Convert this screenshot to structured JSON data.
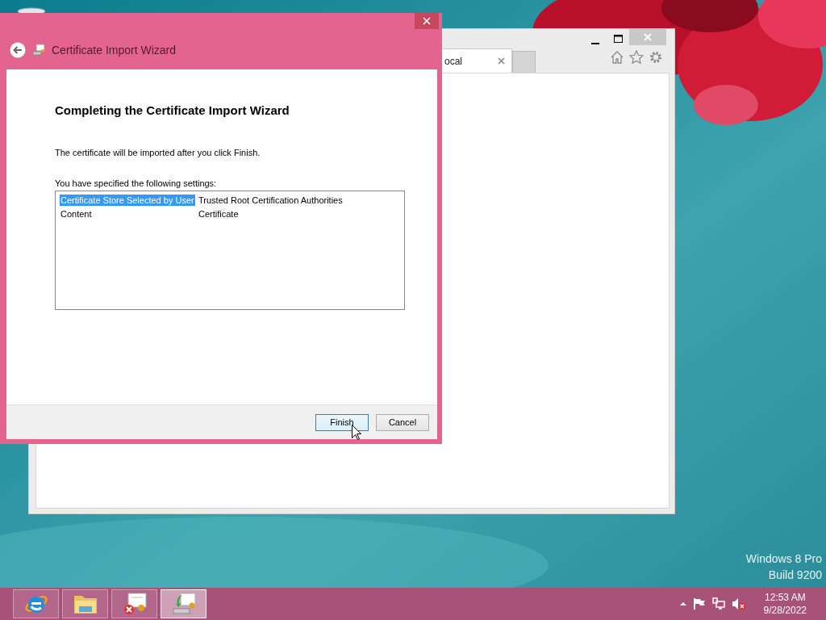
{
  "desktop": {
    "edition": "Windows 8 Pro",
    "build": "Build 9200"
  },
  "browser": {
    "tab_label": "ocal"
  },
  "wizard": {
    "title": "Certificate Import Wizard",
    "heading": "Completing the Certificate Import Wizard",
    "message": "The certificate will be imported after you click Finish.",
    "settings_label": "You have specified the following settings:",
    "settings": [
      {
        "name": "Certificate Store Selected by User",
        "value": "Trusted Root Certification Authorities",
        "selected": true
      },
      {
        "name": "Content",
        "value": "Certificate",
        "selected": false
      }
    ],
    "buttons": [
      {
        "label": "Finish",
        "default": true
      },
      {
        "label": "Cancel",
        "default": false
      }
    ]
  },
  "taskbar": {
    "items": [
      {
        "kind": "browser",
        "selected": false
      },
      {
        "kind": "folder",
        "selected": false
      },
      {
        "kind": "cert-error",
        "selected": false
      },
      {
        "kind": "cert-import",
        "selected": true
      }
    ],
    "time": "12:53 AM",
    "date": "9/28/2022"
  }
}
